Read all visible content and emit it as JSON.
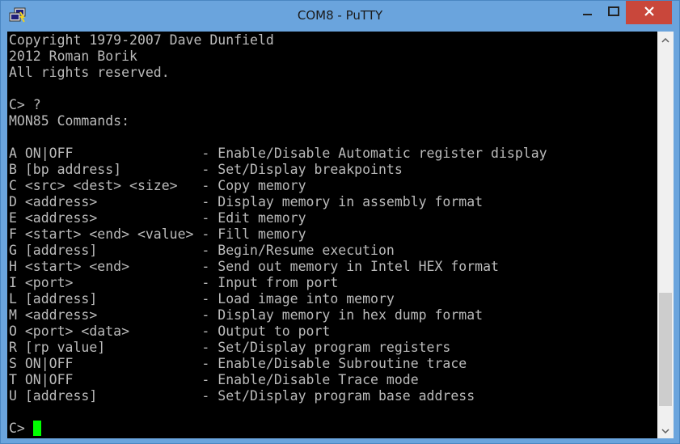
{
  "window": {
    "title": "COM8 - PuTTY"
  },
  "terminal": {
    "lines": [
      "Copyright 1979-2007 Dave Dunfield",
      "2012 Roman Borik",
      "All rights reserved.",
      "",
      "C> ?",
      "MON85 Commands:",
      "",
      "A ON|OFF                - Enable/Disable Automatic register display",
      "B [bp address]          - Set/Display breakpoints",
      "C <src> <dest> <size>   - Copy memory",
      "D <address>             - Display memory in assembly format",
      "E <address>             - Edit memory",
      "F <start> <end> <value> - Fill memory",
      "G [address]             - Begin/Resume execution",
      "H <start> <end>         - Send out memory in Intel HEX format",
      "I <port>                - Input from port",
      "L [address]             - Load image into memory",
      "M <address>             - Display memory in hex dump format",
      "O <port> <data>         - Output to port",
      "R [rp value]            - Set/Display program registers",
      "S ON|OFF                - Enable/Disable Subroutine trace",
      "T ON|OFF                - Enable/Disable Trace mode",
      "U [address]             - Set/Display program base address",
      "",
      "C> "
    ]
  },
  "colors": {
    "titlebar": "#6aa4dd",
    "terminal_bg": "#000000",
    "terminal_fg": "#bbbbbb",
    "cursor": "#00ff00",
    "close_button": "#c9473b"
  },
  "icons": {
    "app": "putty-icon",
    "minimize": "minimize-icon",
    "maximize": "maximize-icon",
    "close": "close-icon",
    "scroll_up": "chevron-up-icon",
    "scroll_down": "chevron-down-icon"
  },
  "scroll": {
    "thumb_start_fraction": 0.654,
    "thumb_size_fraction": 0.302
  }
}
